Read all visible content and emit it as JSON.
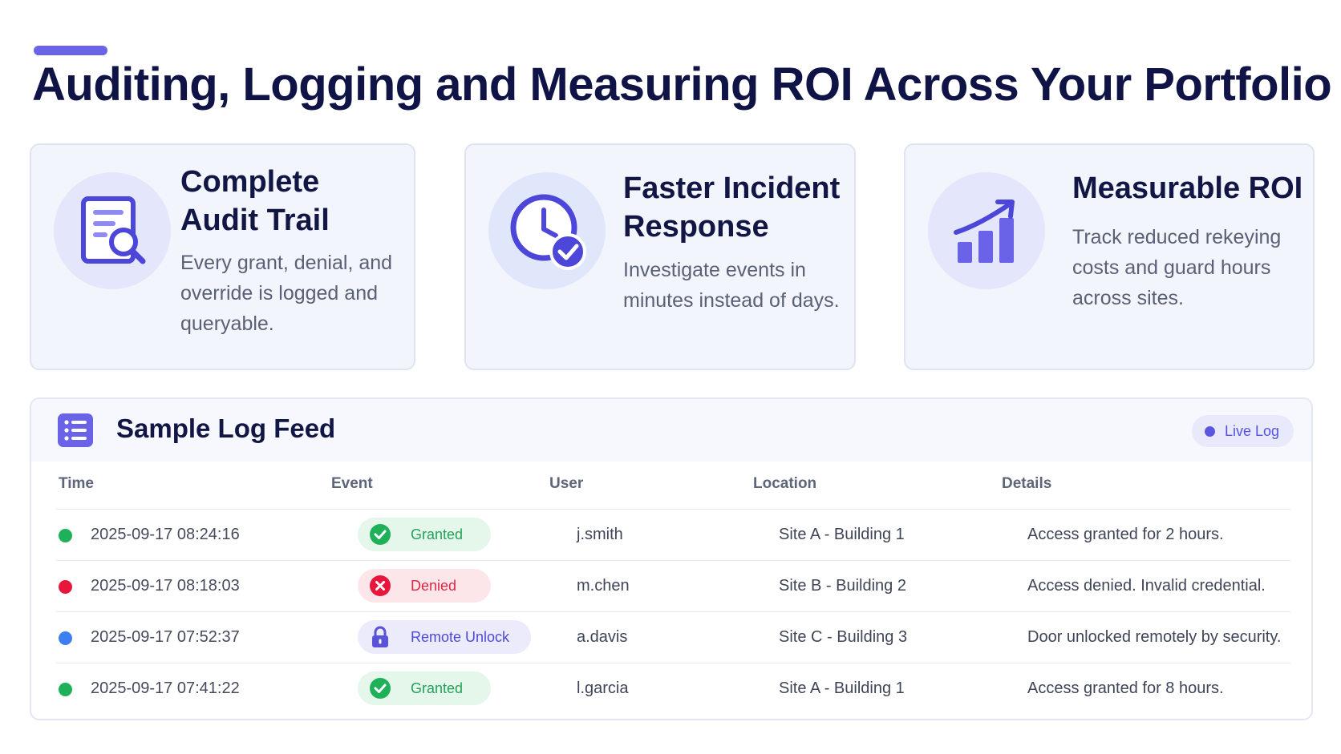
{
  "page": {
    "title": "Auditing, Logging and Measuring ROI Across Your Portfolio"
  },
  "cards": [
    {
      "icon": "audit-document-search-icon",
      "title_line1": "Complete",
      "title_line2": "Audit Trail",
      "text_line1": "Every grant, denial, and",
      "text_line2": "override is logged and",
      "text_line3": "queryable."
    },
    {
      "icon": "clock-check-icon",
      "title_line1": "Faster Incident",
      "title_line2": "Response",
      "text_line1": "Investigate events in",
      "text_line2": "minutes instead of days."
    },
    {
      "icon": "growth-chart-icon",
      "title_line1": "Measurable ROI",
      "text_line1": "Track reduced rekeying",
      "text_line2": "costs and guard hours",
      "text_line3": "across sites."
    }
  ],
  "log": {
    "title": "Sample Log Feed",
    "badge": "Live Log",
    "columns": {
      "time": "Time",
      "event": "Event",
      "user": "User",
      "location": "Location",
      "details": "Details"
    },
    "rows": [
      {
        "time": "2025-09-17  08:24:16",
        "event": "Granted",
        "user": "j.smith",
        "location": "Site A - Building 1",
        "details": "Access granted for 2 hours.",
        "status": "granted"
      },
      {
        "time": "2025-09-17  08:18:03",
        "event": "Denied",
        "user": "m.chen",
        "location": "Site B - Building 2",
        "details": "Access denied. Invalid credential.",
        "status": "denied"
      },
      {
        "time": "2025-09-17  07:52:37",
        "event": "Remote Unlock",
        "user": "a.davis",
        "location": "Site C - Building 3",
        "details": "Door unlocked remotely by security.",
        "status": "remote"
      },
      {
        "time": "2025-09-17  07:41:22",
        "event": "Granted",
        "user": "l.garcia",
        "location": "Site A - Building 1",
        "details": "Access granted for 8 hours.",
        "status": "granted"
      }
    ]
  },
  "colors": {
    "accent": "#6a63e8",
    "granted": "#1fb05a",
    "denied": "#e8163c",
    "remote": "#3d7ff0"
  }
}
